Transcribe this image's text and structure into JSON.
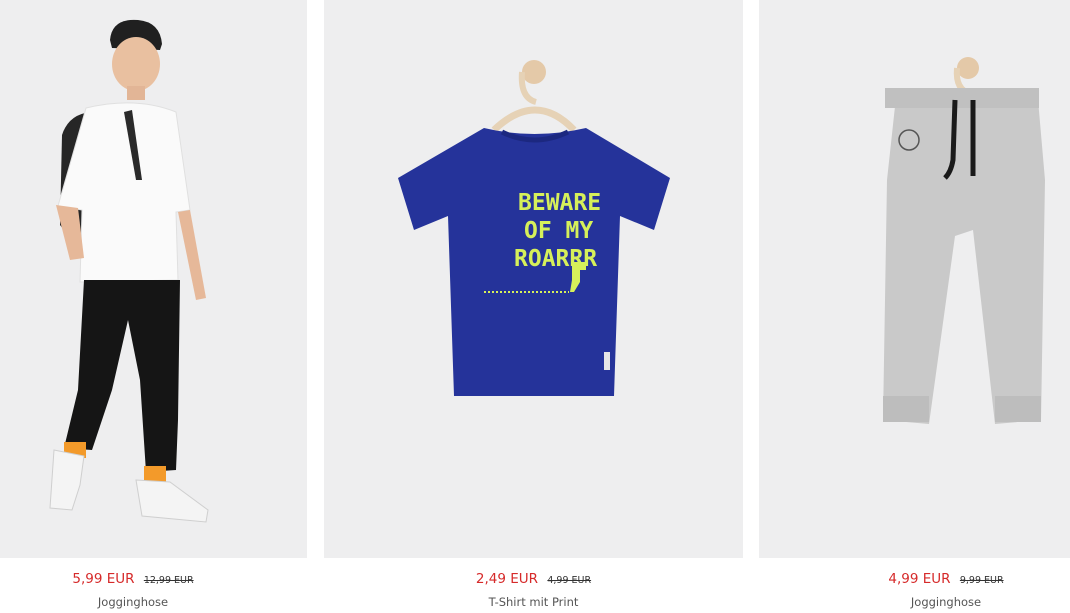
{
  "products": [
    {
      "price": "5,99 EUR",
      "old_price": "12,99 EUR",
      "name": "Jogginghose"
    },
    {
      "price": "2,49 EUR",
      "old_price": "4,99 EUR",
      "name": "T-Shirt mit Print",
      "print_text": [
        "BEWARE",
        "OF MY",
        "ROARRR"
      ]
    },
    {
      "price": "4,99 EUR",
      "old_price": "9,99 EUR",
      "name": "Jogginghose"
    }
  ],
  "colors": {
    "sale_price": "#d62a2a",
    "tshirt": "#25339a",
    "print": "#d6f05a",
    "pants": "#c8c8c8"
  }
}
